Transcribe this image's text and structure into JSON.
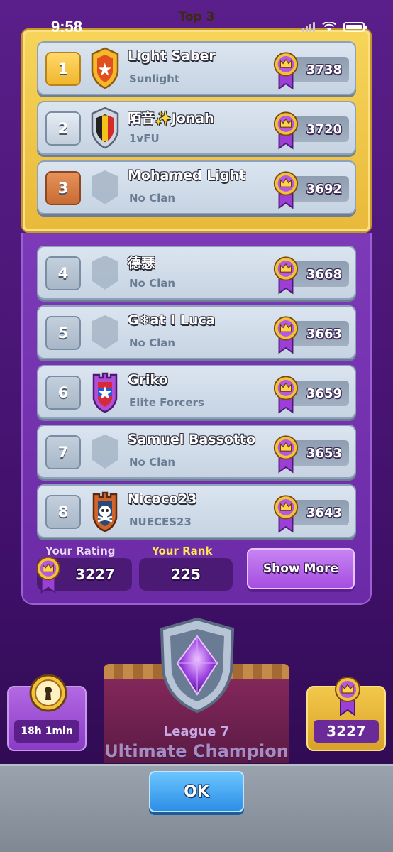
{
  "status_bar": {
    "time": "9:58"
  },
  "header": {
    "title": "Top 3"
  },
  "leaderboard": [
    {
      "rank": "1",
      "name": "Light Saber",
      "clan": "Sunlight",
      "trophies": "3738",
      "tier": "gold",
      "badge": "gold-shield"
    },
    {
      "rank": "2",
      "name": "陌音✨Jonah",
      "clan": "1vFU",
      "trophies": "3720",
      "tier": "silver",
      "badge": "flag-shield"
    },
    {
      "rank": "3",
      "name": "Mohamed Light",
      "clan": "No Clan",
      "trophies": "3692",
      "tier": "bronze",
      "badge": "empty-shield"
    },
    {
      "rank": "4",
      "name": "德瑟",
      "clan": "No Clan",
      "trophies": "3668",
      "tier": "normal",
      "badge": "empty-shield"
    },
    {
      "rank": "5",
      "name": "G❄at I Luca",
      "clan": "No Clan",
      "trophies": "3663",
      "tier": "normal",
      "badge": "empty-shield"
    },
    {
      "rank": "6",
      "name": "Griko",
      "clan": "Elite Forcers",
      "trophies": "3659",
      "tier": "normal",
      "badge": "star-shield"
    },
    {
      "rank": "7",
      "name": "Samuel Bassotto",
      "clan": "No Clan",
      "trophies": "3653",
      "tier": "normal",
      "badge": "empty-shield"
    },
    {
      "rank": "8",
      "name": "Nicoco23",
      "clan": "NUECES23",
      "trophies": "3643",
      "tier": "normal",
      "badge": "skull-shield"
    }
  ],
  "stats": {
    "your_rating_label": "Your Rating",
    "your_rating_value": "3227",
    "your_rank_label": "Your Rank",
    "your_rank_value": "225",
    "show_more_label": "Show More"
  },
  "league": {
    "subtitle": "League 7",
    "title": "Ultimate Champion"
  },
  "side": {
    "timer_value": "18h 1min",
    "rating_value": "3227"
  },
  "footer": {
    "ok_label": "OK"
  },
  "colors": {
    "gold_panel": "#f6d55a",
    "purple_panel": "#7d3ab8",
    "row_bg": "#dbe5f0",
    "ok_button": "#2d8fe6"
  }
}
